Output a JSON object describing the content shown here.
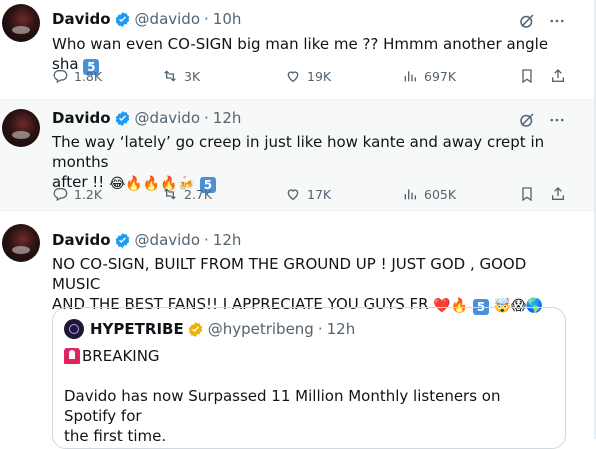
{
  "tweets": [
    {
      "name": "Davido",
      "handle": "@davido",
      "sep": "·",
      "time": "10h",
      "text": "Who wan even CO-SIGN big man like me ?? Hmmm another angle sha",
      "badge": "5",
      "stats": {
        "replies": "1.8K",
        "retweets": "3K",
        "likes": "19K",
        "views": "697K"
      }
    },
    {
      "name": "Davido",
      "handle": "@davido",
      "sep": "·",
      "time": "12h",
      "text_line1": "The way ‘lately’ go creep in just like how kante and away crept in months",
      "text_line2": "after !!",
      "emojis": "😂🔥🔥🔥🍻",
      "badge": "5",
      "stats": {
        "replies": "1.2K",
        "retweets": "2.7K",
        "likes": "17K",
        "views": "605K"
      }
    },
    {
      "name": "Davido",
      "handle": "@davido",
      "sep": "·",
      "time": "12h",
      "text_line1": "NO CO-SIGN, BUILT FROM THE GROUND UP ! JUST GOD , GOOD MUSIC",
      "text_line2": "AND THE BEST FANS!! I APPRECIATE YOU GUYS FR",
      "emojis_a": "❤️🔥",
      "badge": "5",
      "emojis_b": "🤯😱🌎",
      "quote": {
        "name": "HYPETRIBE",
        "handle": "@hypetribeng",
        "sep": "·",
        "time": "12h",
        "breaking": "BREAKING",
        "text_line1": "Davido has now Surpassed 11 Million Monthly listeners on Spotify for",
        "text_line2": "the first time."
      }
    }
  ],
  "icons": {
    "verified": "verified-badge-icon",
    "grok": "slash-circle-icon",
    "more": "more-icon",
    "reply": "reply-icon",
    "retweet": "retweet-icon",
    "like": "heart-icon",
    "views": "views-bar-icon",
    "bookmark": "bookmark-icon",
    "share": "share-icon"
  },
  "colors": {
    "verified": "#1d9bf0",
    "verified_gold": "#e8b600",
    "text": "#0f1419",
    "muted": "#536471"
  }
}
